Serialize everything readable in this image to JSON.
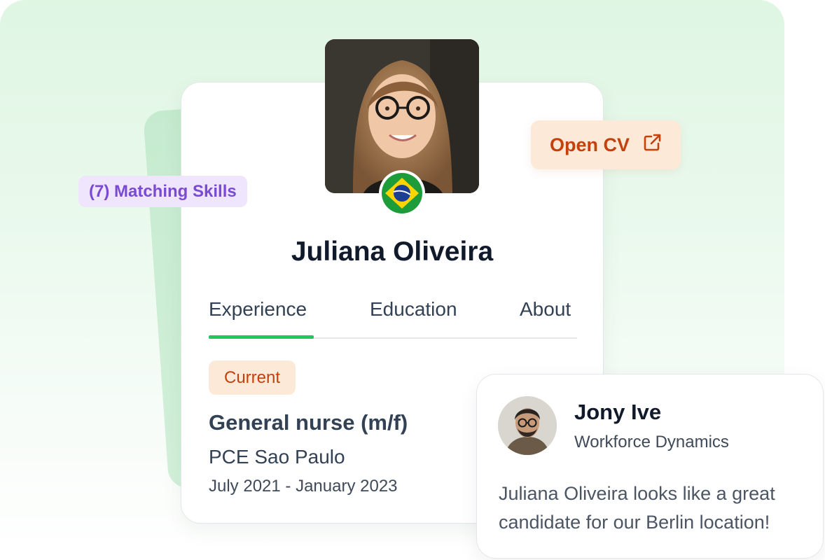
{
  "skills_badge": {
    "label": "(7) Matching Skills"
  },
  "open_cv": {
    "label": "Open CV",
    "icon": "external-link-icon"
  },
  "candidate": {
    "name": "Juliana Oliveira",
    "country_flag": "brazil-flag-icon"
  },
  "tabs": [
    {
      "label": "Experience",
      "active": true
    },
    {
      "label": "Education",
      "active": false
    },
    {
      "label": "About",
      "active": false
    }
  ],
  "experience": {
    "badge": "Current",
    "title": "General nurse (m/f)",
    "company": "PCE Sao Paulo",
    "dates": "July 2021 - January 2023"
  },
  "review": {
    "name": "Jony Ive",
    "company": "Workforce Dynamics",
    "message": "Juliana Oliveira looks like a great candidate for our Berlin location!"
  },
  "colors": {
    "accent_green": "#22c55e",
    "accent_orange": "#c2410c",
    "orange_bg": "#fde9d7",
    "accent_purple": "#7a4bd1",
    "purple_bg": "#efe5fc"
  }
}
